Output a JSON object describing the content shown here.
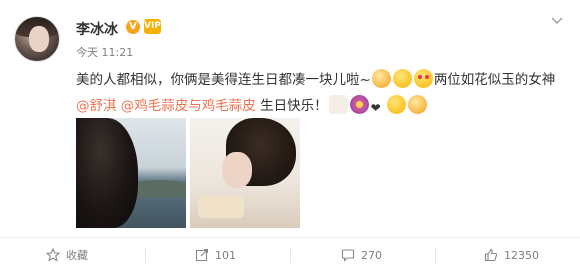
{
  "post": {
    "author": "李冰冰",
    "verified_badge": "V",
    "member_badge": "VIP",
    "timestamp": "今天 11:21",
    "text_line1": "美的人都相似，你俩是美得连生日都凑一块儿啦~",
    "text_line1_suffix": "两位如花似玉的女神",
    "mention1": "@舒淇",
    "mention2": "@鸡毛蒜皮与鸡毛蒜皮",
    "text_line2_suffix": " 生日快乐！",
    "accent_color": "#eb7350"
  },
  "actions": {
    "favorite_label": "收藏",
    "repost_count": "101",
    "comment_count": "270",
    "like_count": "12350"
  }
}
